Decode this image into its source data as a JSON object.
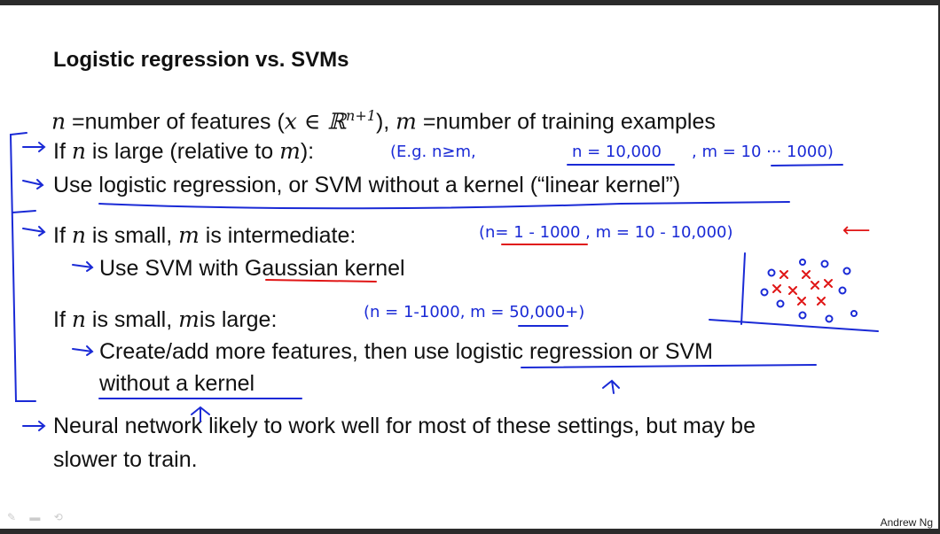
{
  "title": "Logistic regression vs. SVMs",
  "definitions": {
    "n_symbol": "n",
    "n_def": " =number of features (",
    "x_in_R": "x ∈ ℝ",
    "exponent": "n+1",
    "close": "),",
    "m_symbol": "m",
    "m_def": " =number of training examples"
  },
  "case1": {
    "line1_pre": "If ",
    "n": "n",
    "line1_post": " is large (relative to ",
    "m": "m",
    "line1_end": "):",
    "line2": "Use logistic regression, or SVM without a kernel (“linear kernel”)"
  },
  "case2": {
    "line1_pre": "If ",
    "n": "n",
    "line1_mid": " is small, ",
    "m": "m",
    "line1_post": " is intermediate:",
    "line2": "Use SVM with Gaussian kernel"
  },
  "case3": {
    "line1_pre": "If ",
    "n": "n",
    "line1_mid": " is small, ",
    "m": "m",
    "line1_post": "is large:",
    "line2": "Create/add more features, then use logistic regression or SVM",
    "line3": "without a kernel"
  },
  "neural": {
    "line1": "Neural network likely to work well for most of these settings, but may be",
    "line2": "slower to train."
  },
  "annotations": {
    "case1_note": "(E.g.  n≥m,",
    "case1_n": "n = 10,000",
    "case1_m": ",  m = 10 ··· 1000)",
    "case2_note": "(n= 1 - 1000 ,  m = 10 - 10,000)",
    "case2_arrow": "⟵",
    "case3_note": "(n = 1-1000,   m = 50,000+)"
  },
  "footer": "Andrew Ng",
  "colors": {
    "ink_blue": "#1a2ad6",
    "ink_red": "#e01515",
    "text": "#111111"
  }
}
